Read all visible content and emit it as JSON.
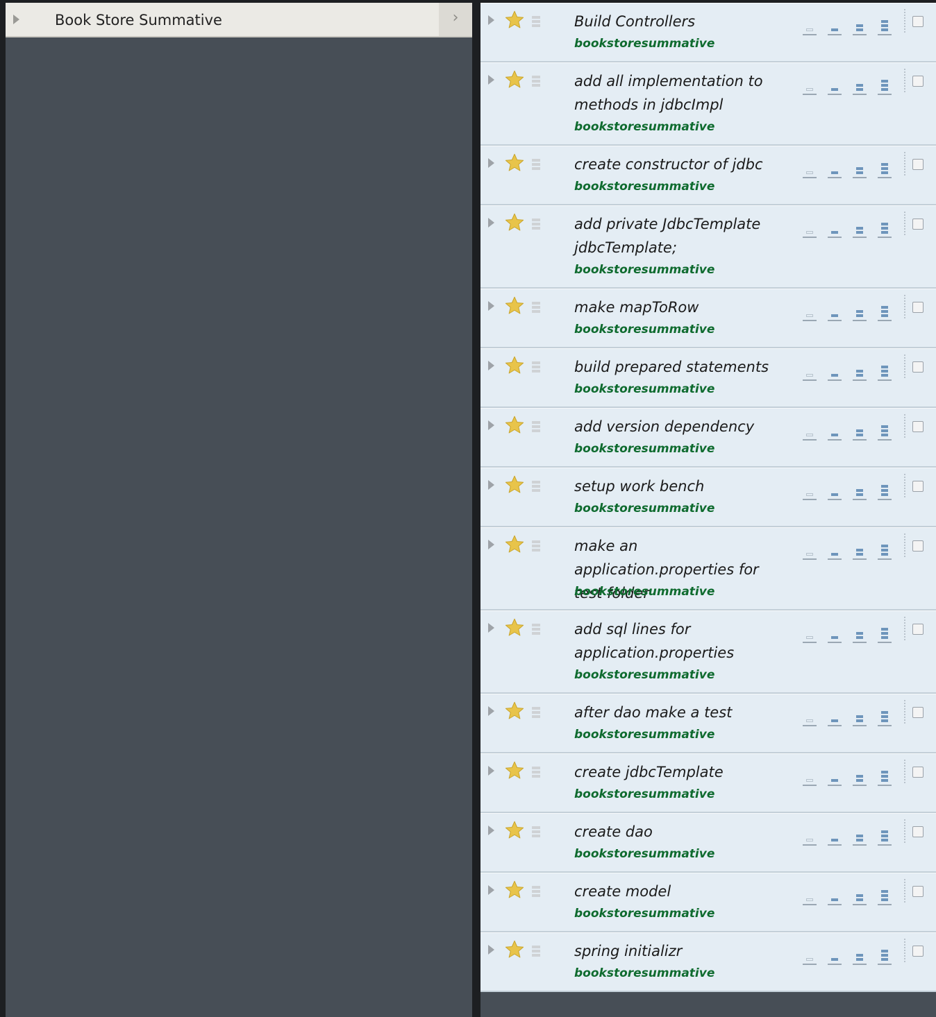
{
  "project_panel": {
    "title": "Book Store Summative",
    "expand_glyph": "›"
  },
  "tasks": [
    {
      "title": "Build Controllers",
      "project": "bookstoresummative",
      "starred": true,
      "done": false
    },
    {
      "title": "add all implementation to methods in jdbcImpl",
      "project": "bookstoresummative",
      "starred": true,
      "done": false
    },
    {
      "title": "create constructor of jdbc",
      "project": "bookstoresummative",
      "starred": true,
      "done": false
    },
    {
      "title": "add private JdbcTemplate jdbcTemplate;",
      "project": "bookstoresummative",
      "starred": true,
      "done": false
    },
    {
      "title": "make mapToRow",
      "project": "bookstoresummative",
      "starred": true,
      "done": false
    },
    {
      "title": "build prepared statements",
      "project": "bookstoresummative",
      "starred": true,
      "done": false
    },
    {
      "title": "add version dependency",
      "project": "bookstoresummative",
      "starred": true,
      "done": false
    },
    {
      "title": "setup work bench",
      "project": "bookstoresummative",
      "starred": true,
      "done": false
    },
    {
      "title": "make an application.properties for test folder",
      "project": "bookstoresummative",
      "starred": true,
      "done": false
    },
    {
      "title": "add sql lines for application.properties",
      "project": "bookstoresummative",
      "starred": true,
      "done": false
    },
    {
      "title": "after dao make a test",
      "project": "bookstoresummative",
      "starred": true,
      "done": false
    },
    {
      "title": "create jdbcTemplate",
      "project": "bookstoresummative",
      "starred": true,
      "done": false
    },
    {
      "title": "create dao",
      "project": "bookstoresummative",
      "starred": true,
      "done": false
    },
    {
      "title": "create model",
      "project": "bookstoresummative",
      "starred": true,
      "done": false
    },
    {
      "title": "spring initializr",
      "project": "bookstoresummative",
      "starred": true,
      "done": false
    }
  ],
  "colors": {
    "star": "#e8c44a",
    "project_tag": "#0f6b2f",
    "priority": "#6e95bb",
    "panel_bg": "#474e56",
    "task_bg": "#e4edf4"
  },
  "icons": {
    "priority_levels": [
      "priority-none-icon",
      "priority-low-icon",
      "priority-medium-icon",
      "priority-high-icon"
    ]
  }
}
